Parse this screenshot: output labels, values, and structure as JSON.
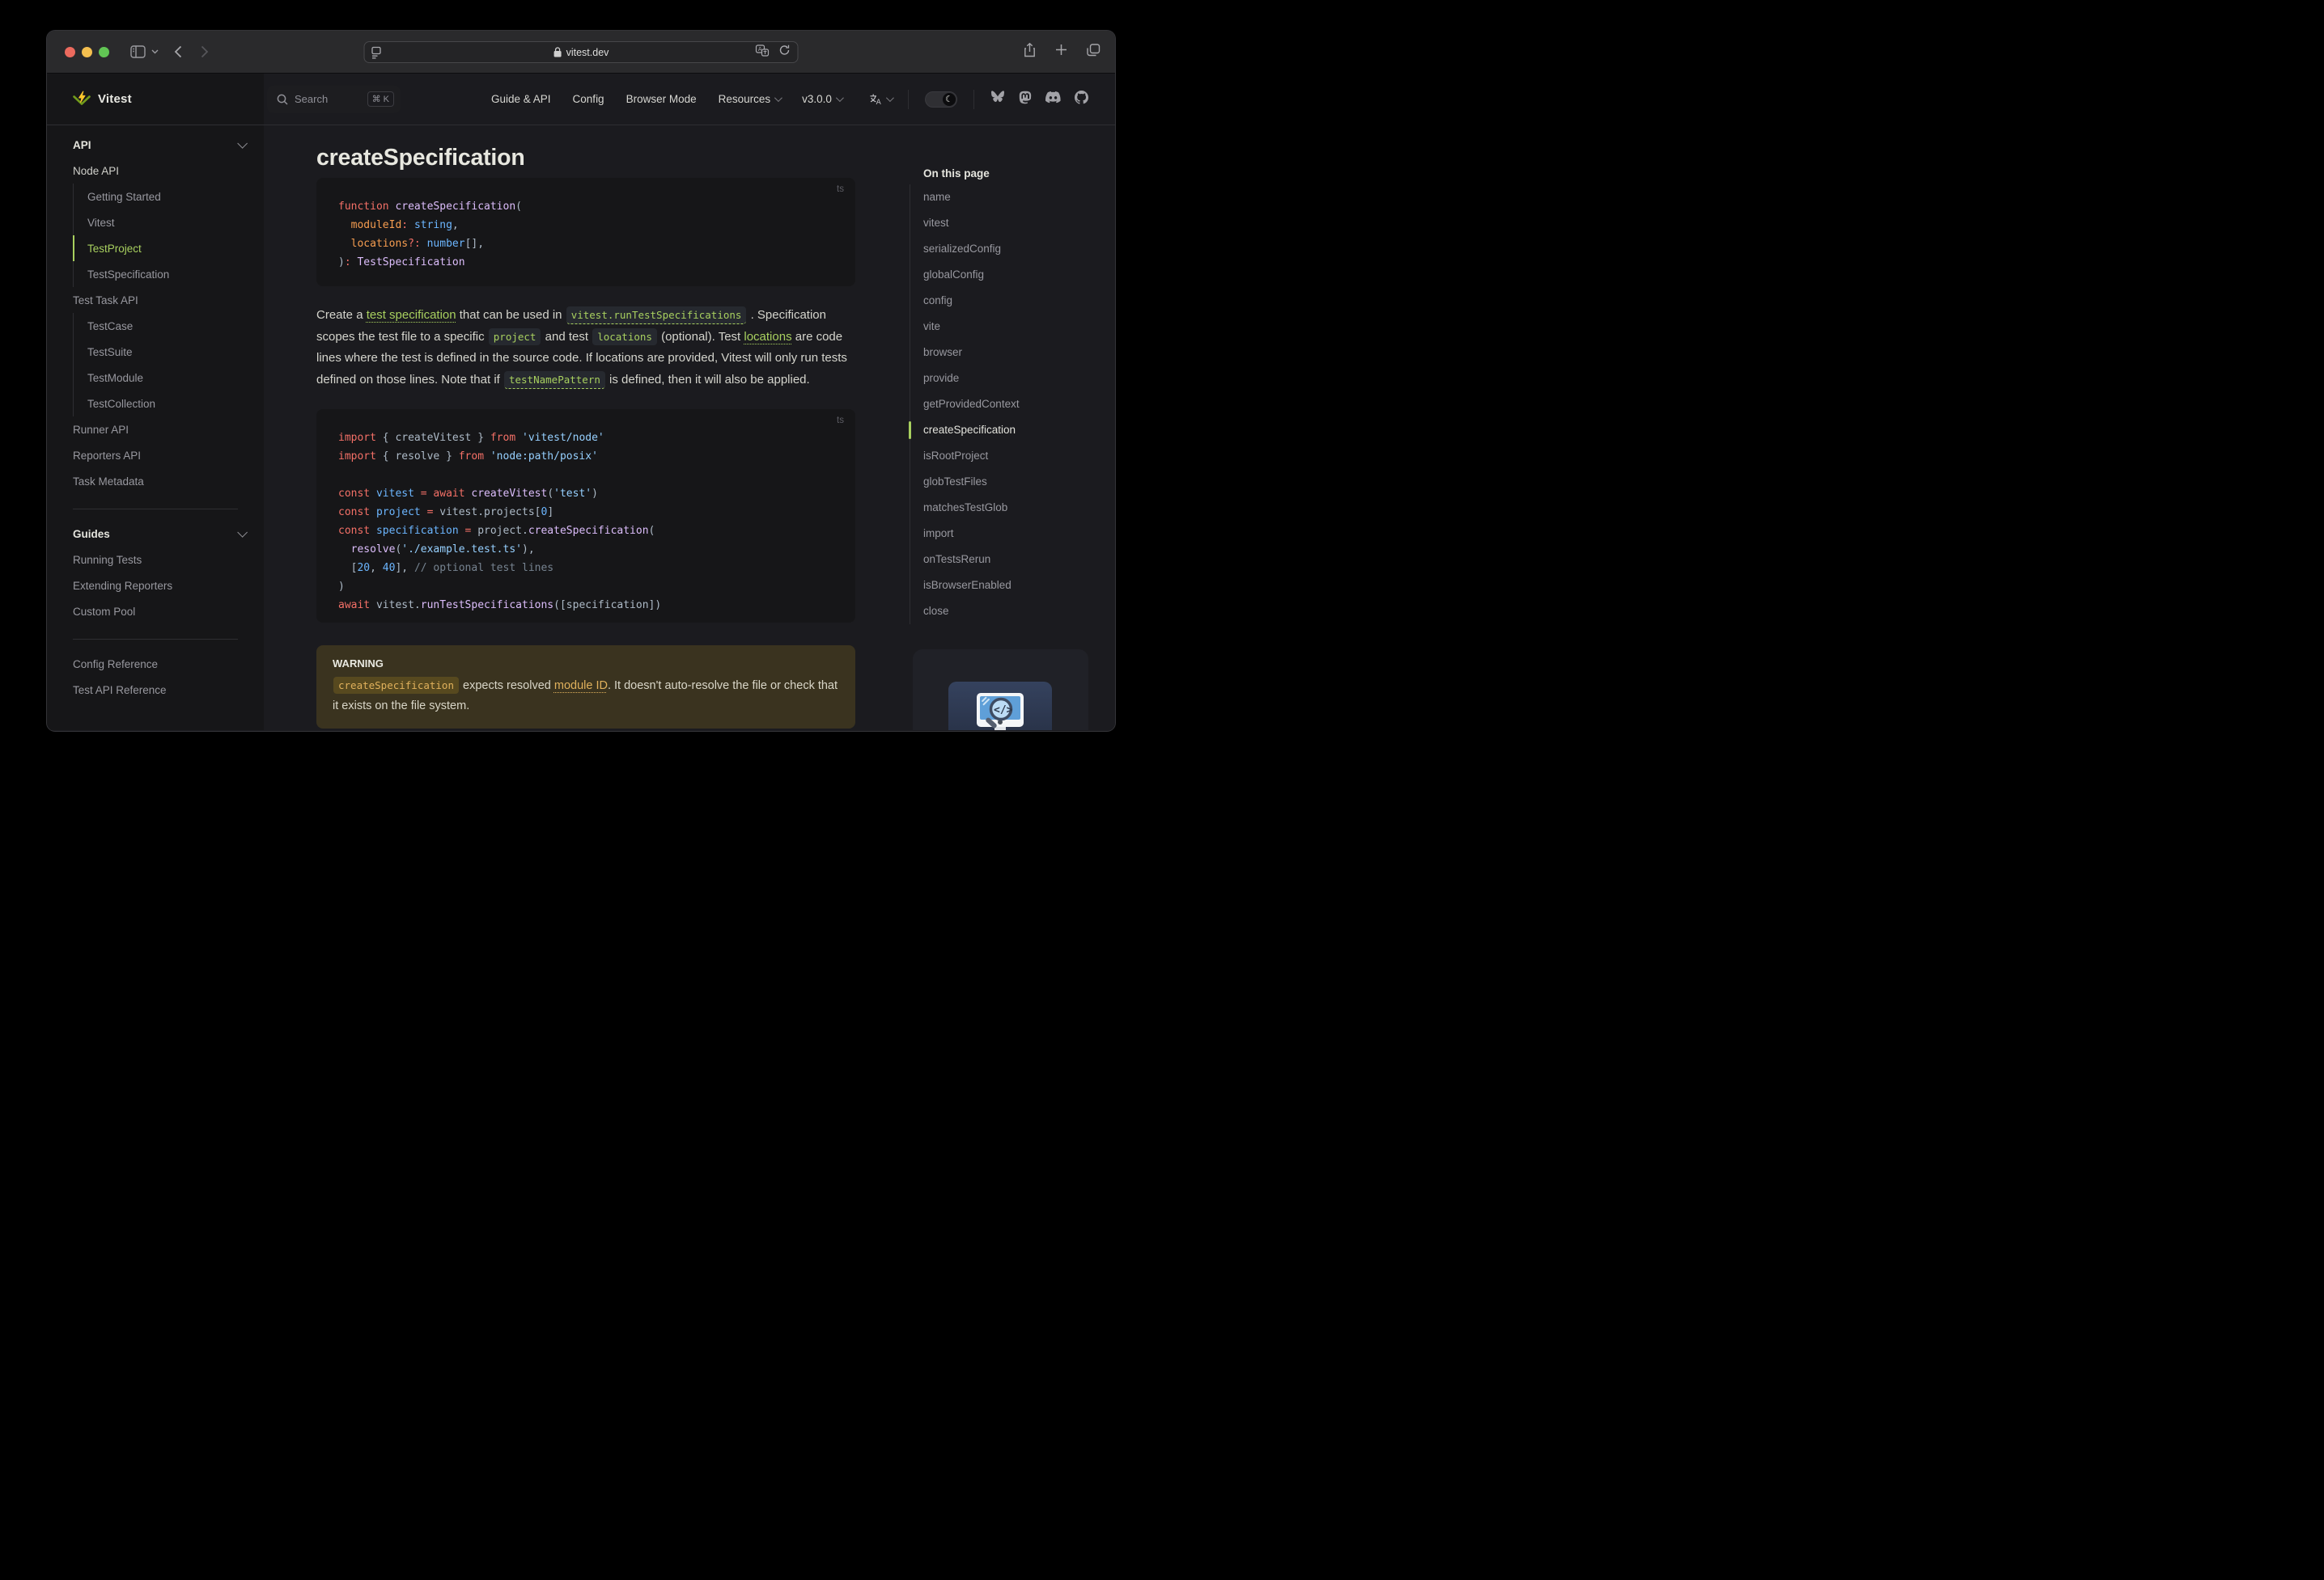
{
  "theme": {
    "brand_green": "#a8d05f",
    "bg": "#1b1b1f",
    "bg_alt": "#161618",
    "divider": "#2e2e32",
    "warning_bg": "#3a331f",
    "warning_code": "#e0b15c",
    "traffic_red": "#ec6a5e",
    "traffic_yellow": "#f4bf4f",
    "traffic_green": "#61c554",
    "code_keyword": "#f47067",
    "code_string": "#96d0ff",
    "code_function": "#dcbdfb",
    "code_constant": "#6cb6ff",
    "code_param": "#f69d50",
    "code_comment": "#768390",
    "code_plain": "#adbac7"
  },
  "chrome": {
    "url": "vitest.dev"
  },
  "header": {
    "logo_text": "Vitest",
    "search": {
      "label": "Search",
      "shortcut": "⌘ K"
    },
    "nav": [
      {
        "label": "Guide & API",
        "dropdown": false
      },
      {
        "label": "Config",
        "dropdown": false
      },
      {
        "label": "Browser Mode",
        "dropdown": false
      },
      {
        "label": "Resources",
        "dropdown": true
      },
      {
        "label": "v3.0.0",
        "dropdown": true
      }
    ]
  },
  "sidebar": {
    "rows": [
      {
        "kind": "group",
        "label": "API"
      },
      {
        "kind": "section",
        "label": "Node API"
      },
      {
        "kind": "child",
        "label": "Getting Started"
      },
      {
        "kind": "child",
        "label": "Vitest"
      },
      {
        "kind": "child",
        "label": "TestProject",
        "active": true
      },
      {
        "kind": "child",
        "label": "TestSpecification"
      },
      {
        "kind": "item",
        "label": "Test Task API"
      },
      {
        "kind": "child",
        "label": "TestCase"
      },
      {
        "kind": "child",
        "label": "TestSuite"
      },
      {
        "kind": "child",
        "label": "TestModule"
      },
      {
        "kind": "child",
        "label": "TestCollection"
      },
      {
        "kind": "item",
        "label": "Runner API"
      },
      {
        "kind": "item",
        "label": "Reporters API"
      },
      {
        "kind": "item",
        "label": "Task Metadata"
      },
      {
        "kind": "divider"
      },
      {
        "kind": "group",
        "label": "Guides"
      },
      {
        "kind": "item",
        "label": "Running Tests"
      },
      {
        "kind": "item",
        "label": "Extending Reporters"
      },
      {
        "kind": "item",
        "label": "Custom Pool"
      },
      {
        "kind": "divider"
      },
      {
        "kind": "item",
        "label": "Config Reference"
      },
      {
        "kind": "item",
        "label": "Test API Reference"
      }
    ]
  },
  "content": {
    "title": "createSpecification",
    "code1": {
      "lang": "ts",
      "lines": [
        [
          [
            "k",
            "function "
          ],
          [
            "fn",
            "createSpecification"
          ],
          [
            "pl",
            "("
          ]
        ],
        [
          [
            "pl",
            "  "
          ],
          [
            "prm",
            "moduleId"
          ],
          [
            "k",
            ":"
          ],
          [
            "pl",
            " "
          ],
          [
            "t",
            "string"
          ],
          [
            "pl",
            ","
          ]
        ],
        [
          [
            "pl",
            "  "
          ],
          [
            "prm",
            "locations"
          ],
          [
            "k",
            "?:"
          ],
          [
            "pl",
            " "
          ],
          [
            "t",
            "number"
          ],
          [
            "pl",
            "[],"
          ]
        ],
        [
          [
            "pl",
            ")"
          ],
          [
            "k",
            ":"
          ],
          [
            "pl",
            " "
          ],
          [
            "fn",
            "TestSpecification"
          ]
        ]
      ]
    },
    "paragraph": [
      {
        "t": "Create a "
      },
      {
        "t": "test specification",
        "type": "link"
      },
      {
        "t": " that can be used in "
      },
      {
        "t": "vitest.runTestSpecifications",
        "type": "code-link"
      },
      {
        "t": " . Specification scopes the test file to a specific "
      },
      {
        "t": "project",
        "type": "code"
      },
      {
        "t": " and test "
      },
      {
        "t": "locations",
        "type": "code"
      },
      {
        "t": " (optional). Test "
      },
      {
        "t": "locations",
        "type": "link"
      },
      {
        "t": " are code lines where the test is defined in the source code. If locations are provided, Vitest will only run tests defined on those lines. Note that if "
      },
      {
        "t": "testNamePattern",
        "type": "code-link"
      },
      {
        "t": " is defined, then it will also be applied."
      }
    ],
    "code2": {
      "lang": "ts",
      "lines": [
        [
          [
            "k",
            "import "
          ],
          [
            "pl",
            "{ createVitest } "
          ],
          [
            "k",
            "from "
          ],
          [
            "s",
            "'vitest/node'"
          ]
        ],
        [
          [
            "k",
            "import "
          ],
          [
            "pl",
            "{ resolve } "
          ],
          [
            "k",
            "from "
          ],
          [
            "s",
            "'node:path/posix'"
          ]
        ],
        [],
        [
          [
            "k",
            "const "
          ],
          [
            "v",
            "vitest"
          ],
          [
            "pl",
            " "
          ],
          [
            "k",
            "="
          ],
          [
            "pl",
            " "
          ],
          [
            "k",
            "await "
          ],
          [
            "fn",
            "createVitest"
          ],
          [
            "pl",
            "("
          ],
          [
            "s",
            "'test'"
          ],
          [
            "pl",
            ")"
          ]
        ],
        [
          [
            "k",
            "const "
          ],
          [
            "v",
            "project"
          ],
          [
            "pl",
            " "
          ],
          [
            "k",
            "="
          ],
          [
            "pl",
            " "
          ],
          [
            "pl",
            "vitest.projects["
          ],
          [
            "n",
            "0"
          ],
          [
            "pl",
            "]"
          ]
        ],
        [
          [
            "k",
            "const "
          ],
          [
            "v",
            "specification"
          ],
          [
            "pl",
            " "
          ],
          [
            "k",
            "="
          ],
          [
            "pl",
            " "
          ],
          [
            "pl",
            "project."
          ],
          [
            "fn",
            "createSpecification"
          ],
          [
            "pl",
            "("
          ]
        ],
        [
          [
            "pl",
            "  "
          ],
          [
            "fn",
            "resolve"
          ],
          [
            "pl",
            "("
          ],
          [
            "s",
            "'./example.test.ts'"
          ],
          [
            "pl",
            "),"
          ]
        ],
        [
          [
            "pl",
            "  ["
          ],
          [
            "n",
            "20"
          ],
          [
            "pl",
            ", "
          ],
          [
            "n",
            "40"
          ],
          [
            "pl",
            "], "
          ],
          [
            "c",
            "// optional test lines"
          ]
        ],
        [
          [
            "pl",
            ")"
          ]
        ],
        [
          [
            "k",
            "await "
          ],
          [
            "pl",
            "vitest."
          ],
          [
            "fn",
            "runTestSpecifications"
          ],
          [
            "pl",
            "([specification])"
          ]
        ]
      ]
    },
    "warning": {
      "title": "WARNING",
      "runs": [
        {
          "t": "createSpecification",
          "type": "code"
        },
        {
          "t": " expects resolved "
        },
        {
          "t": "module ID",
          "type": "link"
        },
        {
          "t": ". It doesn't auto-resolve the file or check that it exists on the file system."
        }
      ]
    }
  },
  "toc": {
    "title": "On this page",
    "items": [
      {
        "label": "name"
      },
      {
        "label": "vitest"
      },
      {
        "label": "serializedConfig"
      },
      {
        "label": "globalConfig"
      },
      {
        "label": "config"
      },
      {
        "label": "vite"
      },
      {
        "label": "browser"
      },
      {
        "label": "provide"
      },
      {
        "label": "getProvidedContext"
      },
      {
        "label": "createSpecification",
        "active": true
      },
      {
        "label": "isRootProject"
      },
      {
        "label": "globTestFiles"
      },
      {
        "label": "matchesTestGlob"
      },
      {
        "label": "import"
      },
      {
        "label": "onTestsRerun"
      },
      {
        "label": "isBrowserEnabled"
      },
      {
        "label": "close"
      }
    ]
  },
  "ad_card": {
    "icon": "code-search-monitor-illustration"
  }
}
